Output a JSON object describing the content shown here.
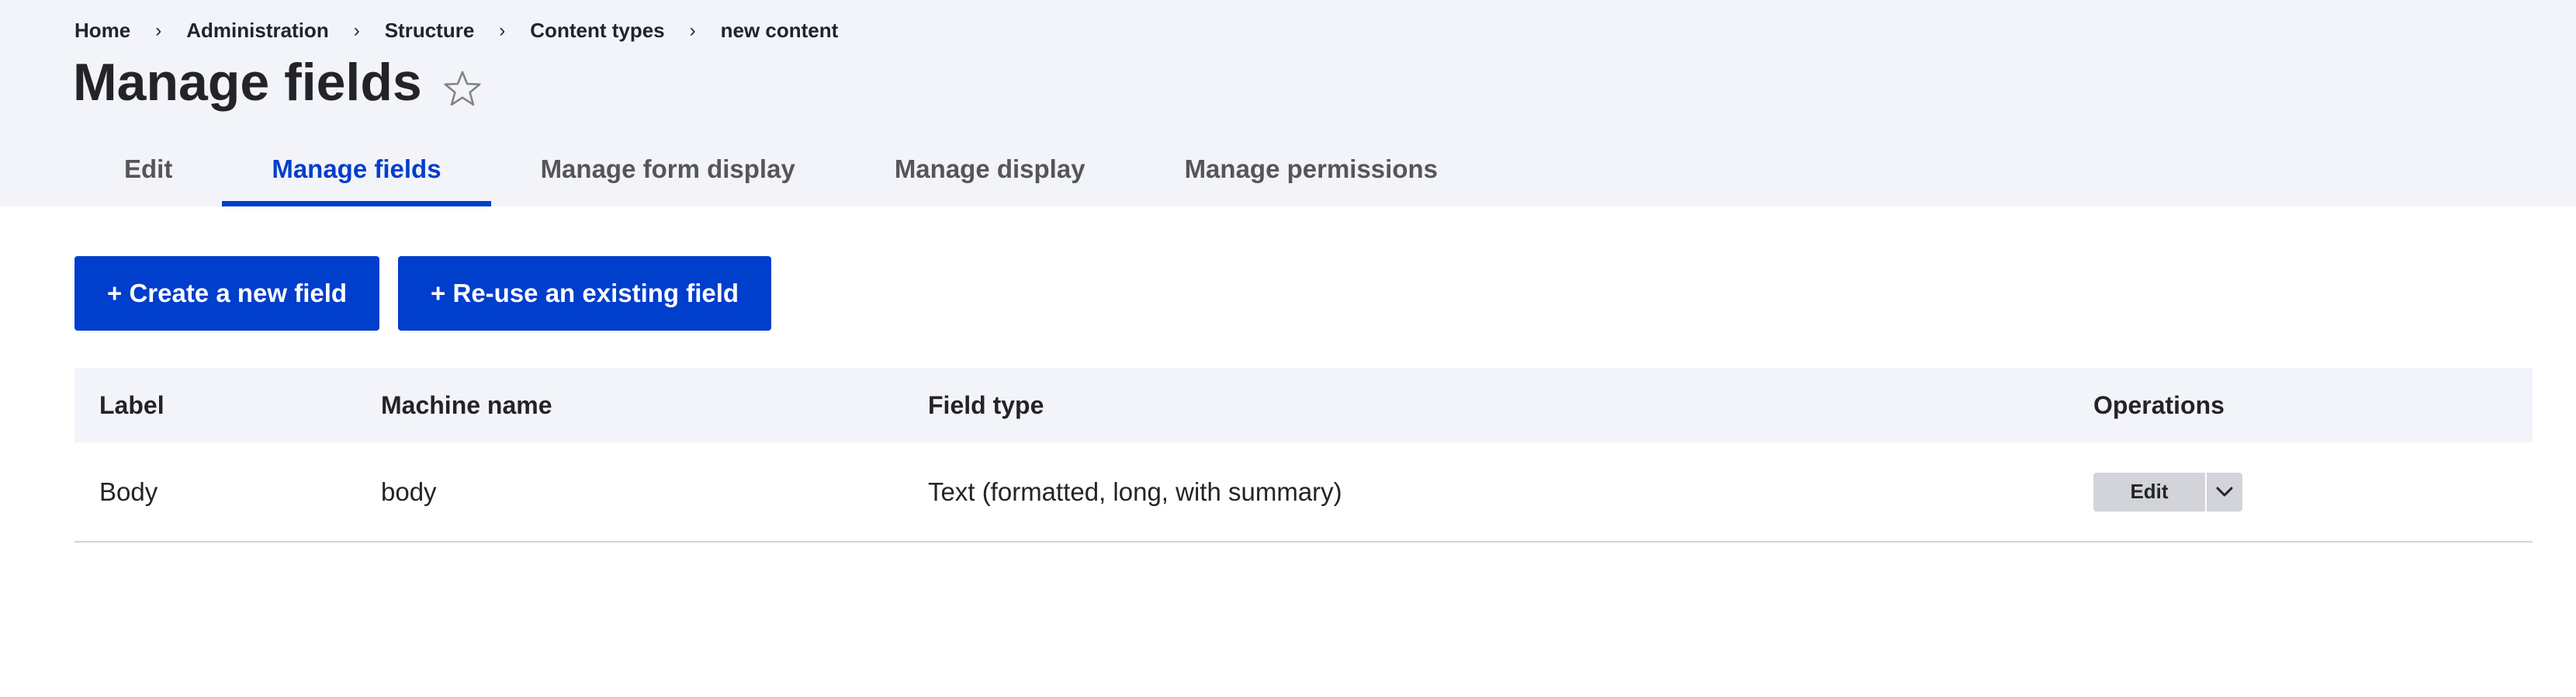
{
  "breadcrumb": [
    {
      "label": "Home"
    },
    {
      "label": "Administration"
    },
    {
      "label": "Structure"
    },
    {
      "label": "Content types"
    },
    {
      "label": "new content"
    }
  ],
  "breadcrumb_separator": "›",
  "page": {
    "title": "Manage fields",
    "star_icon": "star-outline-icon"
  },
  "tabs": [
    {
      "label": "Edit",
      "active": false
    },
    {
      "label": "Manage fields",
      "active": true
    },
    {
      "label": "Manage form display",
      "active": false
    },
    {
      "label": "Manage display",
      "active": false
    },
    {
      "label": "Manage permissions",
      "active": false
    }
  ],
  "actions": {
    "create_label": "+ Create a new field",
    "reuse_label": "+ Re-use an existing field"
  },
  "table": {
    "columns": [
      "Label",
      "Machine name",
      "Field type",
      "Operations"
    ],
    "rows": [
      {
        "label": "Body",
        "machine_name": "body",
        "field_type": "Text (formatted, long, with summary)",
        "operation": "Edit"
      }
    ]
  },
  "colors": {
    "accent": "#003ecc",
    "header_bg": "#f3f4f9",
    "text": "#232429"
  }
}
